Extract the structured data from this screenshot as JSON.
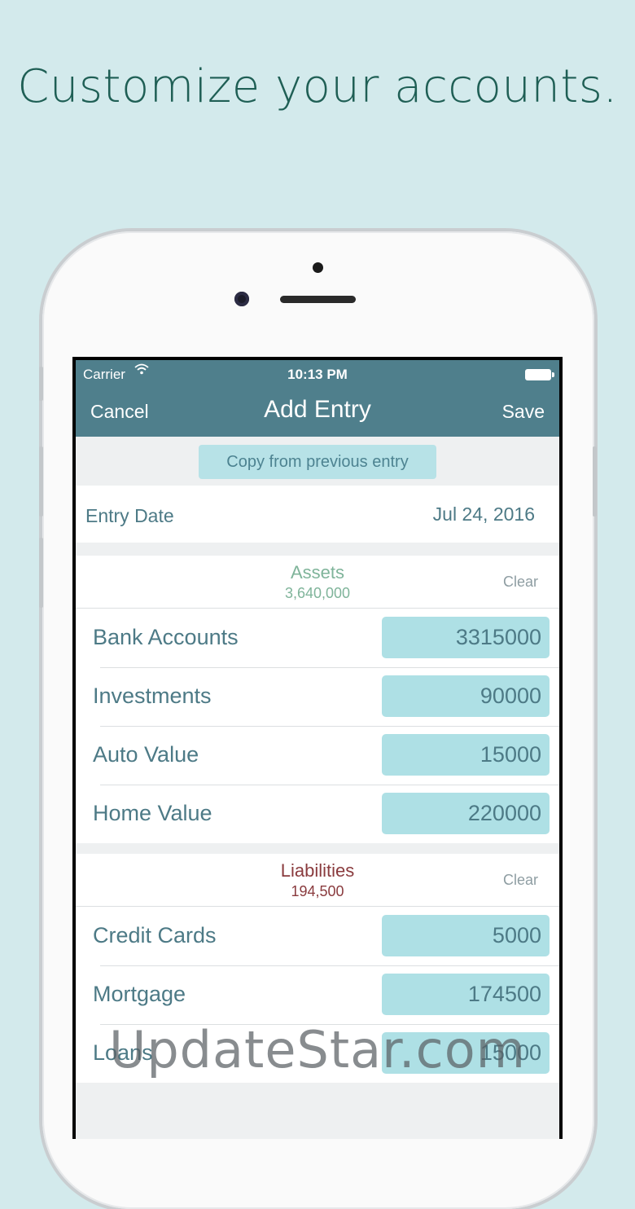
{
  "headline": "Customize your accounts.",
  "status_bar": {
    "carrier": "Carrier",
    "time": "10:13 PM"
  },
  "nav": {
    "cancel": "Cancel",
    "title": "Add Entry",
    "save": "Save"
  },
  "copy_button": "Copy from previous entry",
  "entry_date": {
    "label": "Entry Date",
    "value": "Jul 24, 2016"
  },
  "assets": {
    "title": "Assets",
    "total": "3,640,000",
    "clear": "Clear",
    "rows": [
      {
        "label": "Bank Accounts",
        "value": "3315000"
      },
      {
        "label": "Investments",
        "value": "90000"
      },
      {
        "label": "Auto Value",
        "value": "15000"
      },
      {
        "label": "Home Value",
        "value": "220000"
      }
    ]
  },
  "liabilities": {
    "title": "Liabilities",
    "total": "194,500",
    "clear": "Clear",
    "rows": [
      {
        "label": "Credit Cards",
        "value": "5000"
      },
      {
        "label": "Mortgage",
        "value": "174500"
      },
      {
        "label": "Loans",
        "value": "15000"
      }
    ]
  },
  "watermark": "UpdateStar.com",
  "colors": {
    "background": "#d3eaec",
    "navbar": "#4f7f8c",
    "input_fill": "#aee0e5",
    "assets_accent": "#7fb49a",
    "liabilities_accent": "#8a3b3e"
  }
}
